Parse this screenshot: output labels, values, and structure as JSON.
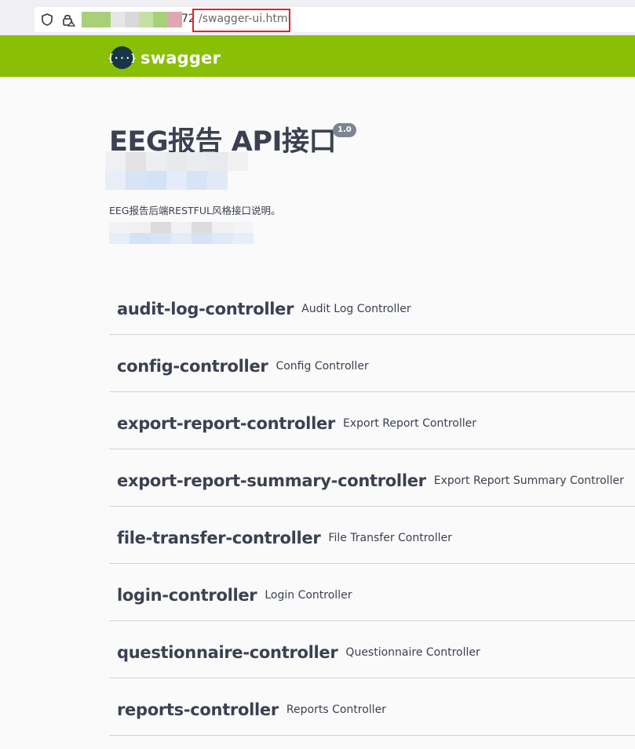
{
  "address_bar": {
    "visible_suffix": "72",
    "path": "/swagger-ui.html",
    "icons": [
      "shield-icon",
      "lock-warning-icon"
    ]
  },
  "topbar": {
    "logo_symbol": "{···}",
    "logo_text": "swagger",
    "color": "#89bf04"
  },
  "info": {
    "title": "EEG报告 API接口",
    "version": "1.0",
    "description": "EEG报告后端RESTFUL风格接口说明。"
  },
  "tags": [
    {
      "name": "audit-log-controller",
      "description": "Audit Log Controller"
    },
    {
      "name": "config-controller",
      "description": "Config Controller"
    },
    {
      "name": "export-report-controller",
      "description": "Export Report Controller"
    },
    {
      "name": "export-report-summary-controller",
      "description": "Export Report Summary Controller"
    },
    {
      "name": "file-transfer-controller",
      "description": "File Transfer Controller"
    },
    {
      "name": "login-controller",
      "description": "Login Controller"
    },
    {
      "name": "questionnaire-controller",
      "description": "Questionnaire Controller"
    },
    {
      "name": "reports-controller",
      "description": "Reports Controller"
    }
  ],
  "colors": {
    "text": "#3b4151",
    "highlight_box": "#e0242b",
    "badge": "#7d8492"
  }
}
